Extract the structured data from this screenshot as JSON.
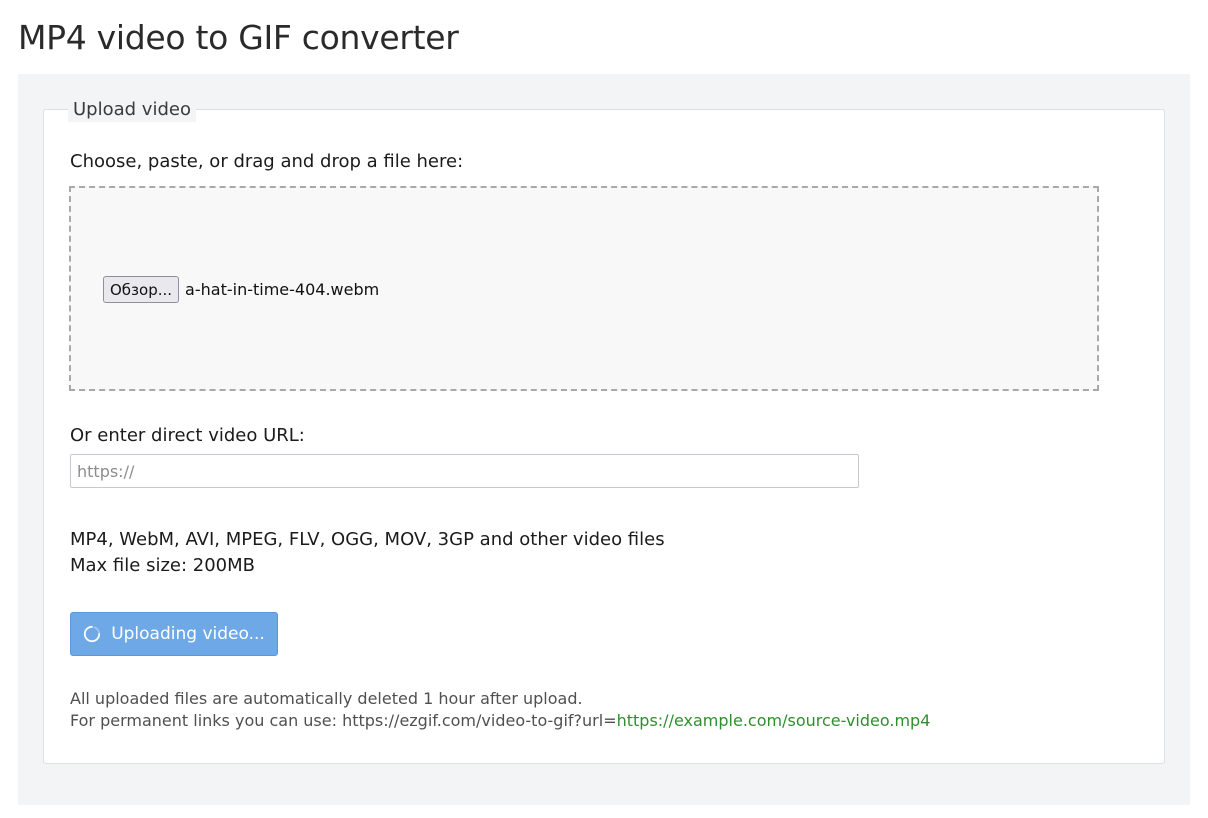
{
  "page": {
    "title": "MP4 video to GIF converter"
  },
  "upload": {
    "legend": "Upload video",
    "choose_label": "Choose, paste, or drag and drop a file here:",
    "browse_label": "Обзор...",
    "selected_file": "a-hat-in-time-404.webm",
    "url_label": "Or enter direct video URL:",
    "url_placeholder": "https://",
    "url_value": "",
    "formats_line": "MP4, WebM, AVI, MPEG, FLV, OGG, MOV, 3GP and other video files",
    "max_size_line": "Max file size: 200MB",
    "upload_button_label": "Uploading video...",
    "upload_button_icon": "spinner-icon"
  },
  "notes": {
    "auto_delete": "All uploaded files are automatically deleted 1 hour after upload.",
    "permanent_prefix": "For permanent links you can use: https://ezgif.com/video-to-gif?url=",
    "permanent_example": "https://example.com/source-video.mp4"
  },
  "colors": {
    "button_bg": "#6fa8e6",
    "link_green": "#2f8f2f",
    "panel_bg": "#f3f4f6"
  }
}
